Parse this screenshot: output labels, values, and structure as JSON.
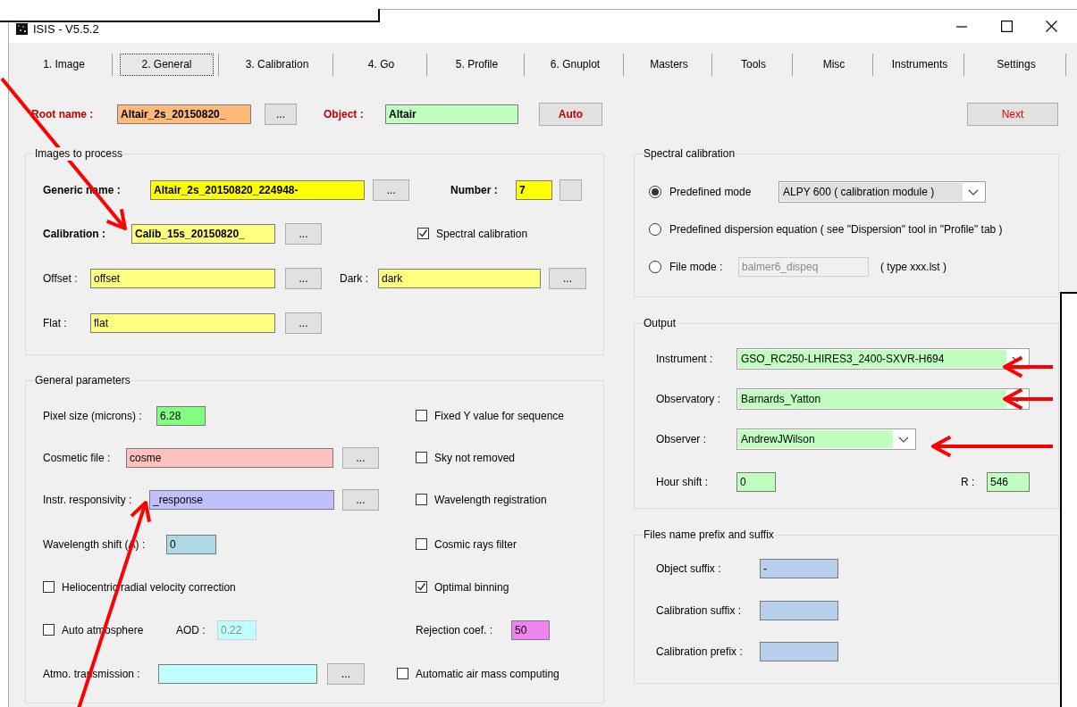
{
  "window": {
    "title": "ISIS - V5.5.2"
  },
  "tabs": [
    {
      "label": "1. Image",
      "selected": false
    },
    {
      "label": "2. General",
      "selected": true
    },
    {
      "label": "3. Calibration",
      "selected": false
    },
    {
      "label": "4. Go",
      "selected": false
    },
    {
      "label": "5. Profile",
      "selected": false
    },
    {
      "label": "6. Gnuplot",
      "selected": false
    },
    {
      "label": "Masters",
      "selected": false
    },
    {
      "label": "Tools",
      "selected": false
    },
    {
      "label": "Misc",
      "selected": false
    },
    {
      "label": "Instruments",
      "selected": false
    },
    {
      "label": "Settings",
      "selected": false
    }
  ],
  "header": [
    {
      "kind": "label",
      "text": "Root name :",
      "bold": true,
      "color": "#c00000"
    },
    {
      "kind": "field",
      "value": "Altair_2s_20150820_",
      "bold": true,
      "color": "#ffb978"
    },
    {
      "kind": "browse",
      "label": "..."
    },
    {
      "kind": "label",
      "text": "Object :",
      "bold": true,
      "color": "#c00000"
    },
    {
      "kind": "field",
      "value": "Altair",
      "bold": true,
      "color": "#c0ffc0"
    },
    {
      "kind": "button",
      "label": "Auto",
      "bold": true,
      "color": "#c00000"
    },
    {
      "kind": "button",
      "label": "Next",
      "color": "#e00000"
    }
  ],
  "left_groups": [
    {
      "title": "Images to process",
      "rows": [
        {
          "items": [
            {
              "kind": "label",
              "text": "Generic name :",
              "bold": true
            },
            {
              "kind": "field",
              "value": "Altair_2s_20150820_224948-",
              "bold": true,
              "color": "#ffff00"
            },
            {
              "kind": "browse",
              "label": "..."
            },
            {
              "kind": "label",
              "text": "Number :",
              "bold": true
            },
            {
              "kind": "field",
              "value": "7",
              "bold": true,
              "color": "#ffff00"
            },
            {
              "kind": "button"
            }
          ]
        },
        {
          "items": [
            {
              "kind": "label",
              "text": "Calibration :",
              "bold": true
            },
            {
              "kind": "field",
              "value": "Calib_15s_20150820_",
              "bold": true,
              "color": "#ffff80"
            },
            {
              "kind": "browse",
              "label": "..."
            },
            {
              "kind": "checkbox",
              "label": "Spectral calibration",
              "checked": true
            }
          ]
        },
        {
          "items": [
            {
              "kind": "label",
              "text": "Offset :"
            },
            {
              "kind": "field",
              "value": "offset",
              "color": "#ffff80"
            },
            {
              "kind": "browse",
              "label": "..."
            },
            {
              "kind": "label",
              "text": "Dark :"
            },
            {
              "kind": "field",
              "value": "dark",
              "color": "#ffff80"
            },
            {
              "kind": "browse",
              "label": "..."
            }
          ]
        },
        {
          "items": [
            {
              "kind": "label",
              "text": "Flat :"
            },
            {
              "kind": "field",
              "value": "flat",
              "color": "#ffff80"
            },
            {
              "kind": "browse",
              "label": "..."
            }
          ]
        }
      ]
    },
    {
      "title": "General parameters",
      "rows": [
        {
          "items": [
            {
              "kind": "label",
              "text": "Pixel size (microns) :"
            },
            {
              "kind": "field",
              "value": "6.28",
              "color": "#80ff80"
            },
            {
              "kind": "checkbox",
              "label": "Fixed Y value for sequence",
              "checked": false
            }
          ]
        },
        {
          "items": [
            {
              "kind": "label",
              "text": "Cosmetic file :"
            },
            {
              "kind": "field",
              "value": "cosme",
              "color": "#ffc0c0"
            },
            {
              "kind": "browse",
              "label": "..."
            },
            {
              "kind": "checkbox",
              "label": "Sky not removed",
              "checked": false
            }
          ]
        },
        {
          "items": [
            {
              "kind": "label",
              "text": "Instr. responsivity :"
            },
            {
              "kind": "field",
              "value": "_response",
              "color": "#c0c0ff"
            },
            {
              "kind": "browse",
              "label": "..."
            },
            {
              "kind": "checkbox",
              "label": "Wavelength registration",
              "checked": false
            }
          ]
        },
        {
          "items": [
            {
              "kind": "label",
              "text": "Wavelength shift (A) :"
            },
            {
              "kind": "field",
              "value": "0",
              "color": "#add8e6"
            },
            {
              "kind": "checkbox",
              "label": "Cosmic rays filter",
              "checked": false
            }
          ]
        },
        {
          "items": [
            {
              "kind": "checkbox",
              "label": "Heliocentric radial velocity correction",
              "checked": false
            },
            {
              "kind": "checkbox",
              "label": "Optimal binning",
              "checked": true
            }
          ]
        },
        {
          "items": [
            {
              "kind": "checkbox",
              "label": "Auto atmosphere",
              "checked": false
            },
            {
              "kind": "label",
              "text": "AOD :"
            },
            {
              "kind": "field",
              "value": "0.22",
              "color": "#c0ffff",
              "disabled": true
            },
            {
              "kind": "label",
              "text": "Rejection coef. :"
            },
            {
              "kind": "field",
              "value": "50",
              "color": "#ee82ee"
            }
          ]
        },
        {
          "items": [
            {
              "kind": "label",
              "text": "Atmo. transmission :"
            },
            {
              "kind": "field",
              "color": "#c0ffff"
            },
            {
              "kind": "browse",
              "label": "..."
            },
            {
              "kind": "checkbox",
              "label": "Automatic air mass computing",
              "checked": false
            }
          ]
        }
      ]
    }
  ],
  "right_groups": [
    {
      "title": "Spectral calibration",
      "rows": [
        {
          "items": [
            {
              "kind": "radio",
              "label": "Predefined mode",
              "selected": true
            },
            {
              "kind": "combo",
              "value": "ALPY 600 ( calibration module )",
              "color": "#e1e1e1"
            }
          ]
        },
        {
          "items": [
            {
              "kind": "radio",
              "label": "Predefined dispersion equation ( see \"Dispersion\" tool in \"Profile\" tab )",
              "selected": false
            }
          ]
        },
        {
          "items": [
            {
              "kind": "radio",
              "label": "File mode :",
              "selected": false
            },
            {
              "kind": "field",
              "value": "balmer6_dispeq",
              "color": "#f0f0f0",
              "disabled": true
            },
            {
              "kind": "note",
              "text": "( type xxx.lst )"
            }
          ]
        }
      ]
    },
    {
      "title": "Output",
      "rows": [
        {
          "items": [
            {
              "kind": "label",
              "text": "Instrument :"
            },
            {
              "kind": "combo",
              "value": "GSO_RC250-LHIRES3_2400-SXVR-H694",
              "color": "#c0ffc0"
            }
          ]
        },
        {
          "items": [
            {
              "kind": "label",
              "text": "Observatory :"
            },
            {
              "kind": "combo",
              "value": "Barnards_Yatton",
              "color": "#c0ffc0"
            }
          ]
        },
        {
          "items": [
            {
              "kind": "label",
              "text": "Observer :"
            },
            {
              "kind": "combo",
              "value": "AndrewJWilson",
              "color": "#c0ffc0"
            }
          ]
        },
        {
          "items": [
            {
              "kind": "label",
              "text": "Hour shift :"
            },
            {
              "kind": "field",
              "value": "0",
              "color": "#c0ffc0"
            },
            {
              "kind": "label",
              "text": "R :"
            },
            {
              "kind": "field",
              "value": "546",
              "color": "#c0ffc0"
            }
          ]
        }
      ]
    },
    {
      "title": "Files name prefix and suffix",
      "rows": [
        {
          "items": [
            {
              "kind": "label",
              "text": "Object suffix :"
            },
            {
              "kind": "field",
              "value": "-",
              "color": "#b8d0ec"
            }
          ]
        },
        {
          "items": [
            {
              "kind": "label",
              "text": "Calibration suffix :"
            },
            {
              "kind": "field",
              "color": "#b8d0ec"
            }
          ]
        },
        {
          "items": [
            {
              "kind": "label",
              "text": "Calibration prefix :"
            },
            {
              "kind": "field",
              "color": "#b8d0ec"
            }
          ]
        }
      ]
    }
  ]
}
